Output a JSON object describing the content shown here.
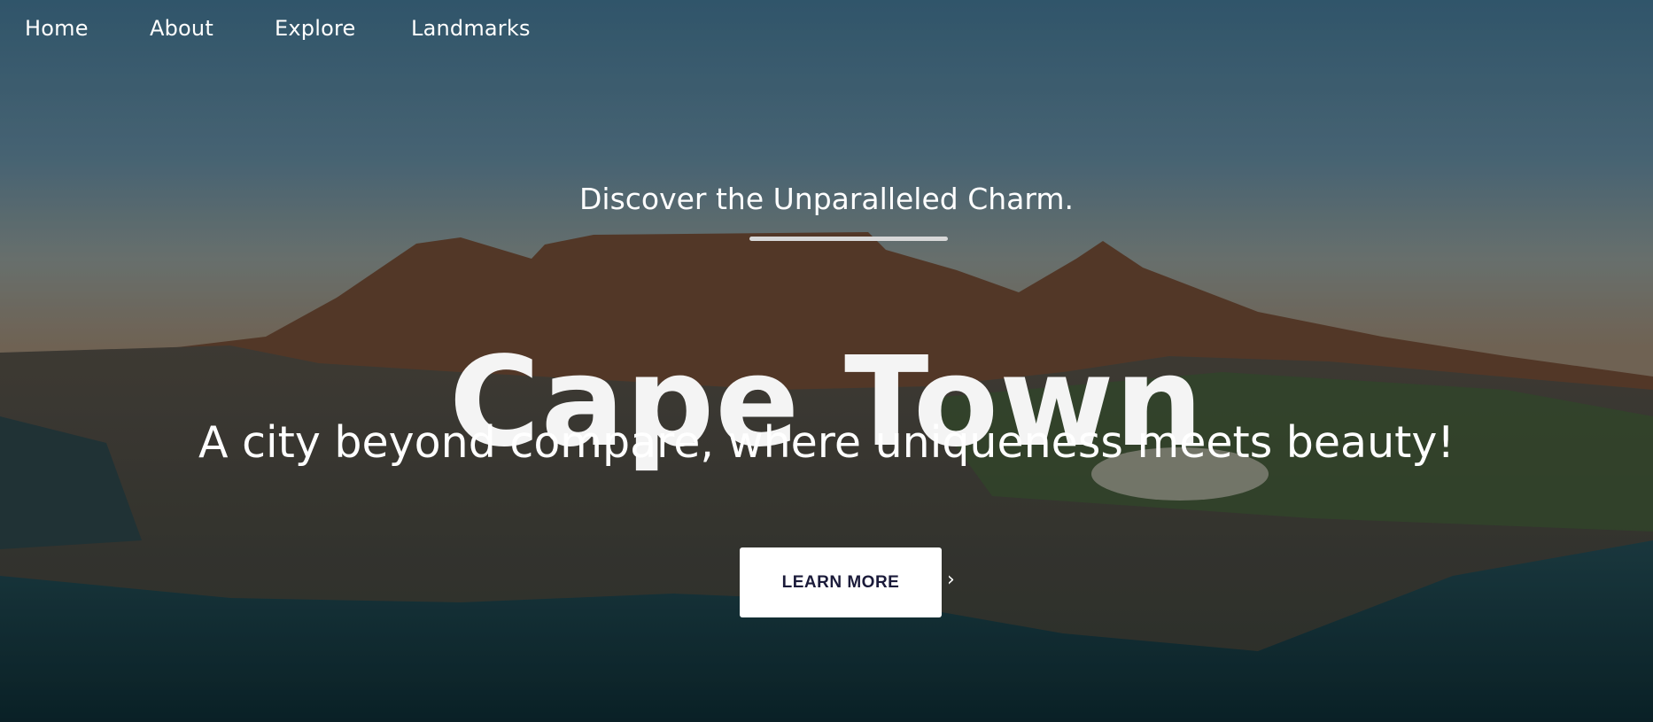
{
  "nav": {
    "items": [
      "Home",
      "About",
      "Explore",
      "Landmarks"
    ]
  },
  "hero": {
    "tagline": "Discover the Unparalleled Charm.",
    "title": "Cape Town",
    "subtitle": "A city beyond compare, where uniqueness meets beauty!",
    "cta_label": "LEARN MORE",
    "cta_icon": "chevron-right-icon"
  },
  "colors": {
    "text": "#ffffff",
    "button_bg": "#ffffff",
    "button_text": "#1b1b3a"
  }
}
